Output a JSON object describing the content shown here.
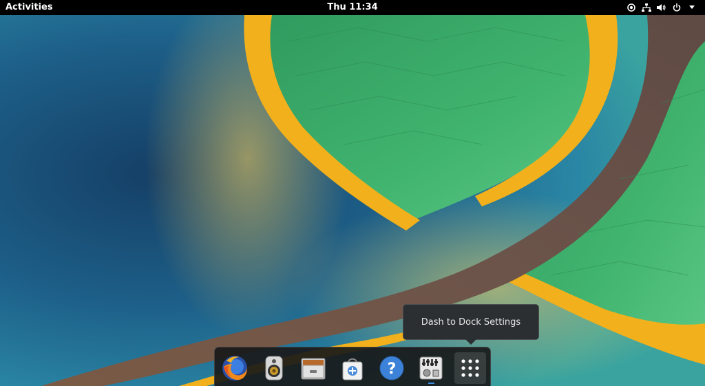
{
  "topbar": {
    "activities_label": "Activities",
    "clock": "Thu 11:34",
    "tray_icons": [
      "accessibility-icon",
      "network-wired-icon",
      "volume-icon",
      "power-icon",
      "chevron-down-icon"
    ]
  },
  "tooltip": {
    "text": "Dash to Dock Settings"
  },
  "dock": {
    "items": [
      {
        "name": "firefox-icon",
        "running": false
      },
      {
        "name": "speaker-app-icon",
        "running": false
      },
      {
        "name": "file-cabinet-icon",
        "running": false
      },
      {
        "name": "software-store-icon",
        "running": false
      },
      {
        "name": "help-icon",
        "running": false
      },
      {
        "name": "settings-mixer-icon",
        "running": true
      },
      {
        "name": "show-applications-icon",
        "running": false
      }
    ]
  },
  "colors": {
    "topbar_bg": "#000000",
    "dock_bg": "#191919",
    "tooltip_bg": "#2b2f31",
    "running_indicator": "#3d8ee6",
    "wallpaper_blue": "#1b5d86",
    "wallpaper_green": "#3dae6a",
    "wallpaper_yellow": "#f5b41b",
    "wallpaper_brown": "#6e5548"
  }
}
